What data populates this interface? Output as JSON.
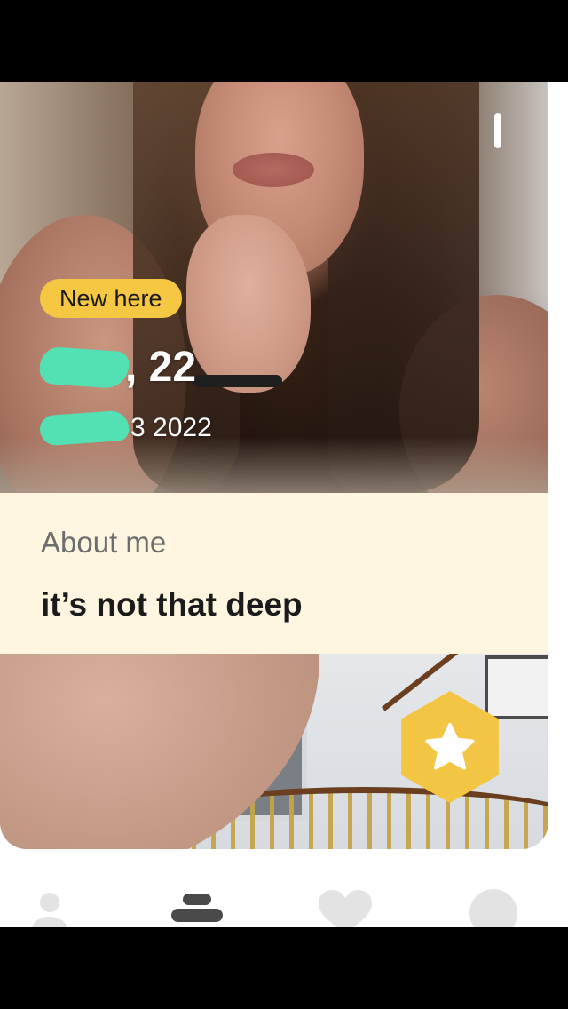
{
  "profile": {
    "badge": "New here",
    "name_age": ", 22",
    "subtitle": "3 2022",
    "about_heading": "About me",
    "about_text": "it’s not that deep"
  },
  "actions": {
    "superswipe_icon": "star-icon"
  },
  "tabbar": {
    "tabs": [
      {
        "icon": "profile-icon",
        "active": false
      },
      {
        "icon": "stack-icon",
        "active": true
      },
      {
        "icon": "heart-icon",
        "active": false
      },
      {
        "icon": "chat-icon",
        "active": false
      }
    ]
  },
  "colors": {
    "badge_bg": "#f5c743",
    "about_bg": "#fdf5df",
    "superswipe_bg": "#f3c544",
    "redaction": "#52e0b4",
    "tab_inactive": "#e3e3e3",
    "tab_active": "#4a4a4a"
  }
}
